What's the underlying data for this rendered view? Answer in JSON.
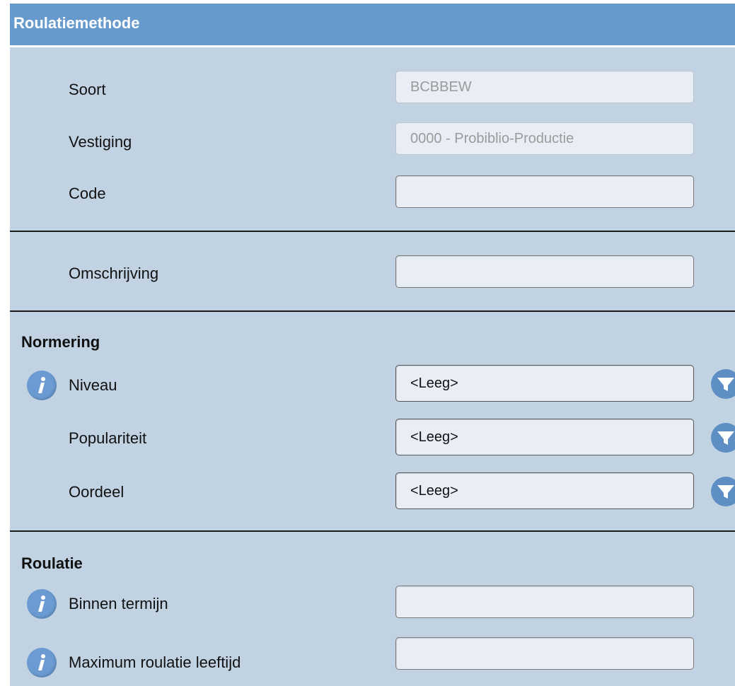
{
  "window": {
    "title": "Roulatiemethode"
  },
  "fields": {
    "soort": {
      "label": "Soort",
      "value": "BCBBEW"
    },
    "vestiging": {
      "label": "Vestiging",
      "value": "0000 - Probiblio-Productie"
    },
    "code": {
      "label": "Code",
      "value": ""
    },
    "omschrijving": {
      "label": "Omschrijving",
      "value": ""
    }
  },
  "normering": {
    "heading": "Normering",
    "niveau": {
      "label": "Niveau",
      "value": "<Leeg>"
    },
    "populariteit": {
      "label": "Populariteit",
      "value": "<Leeg>"
    },
    "oordeel": {
      "label": "Oordeel",
      "value": "<Leeg>"
    }
  },
  "roulatie": {
    "heading": "Roulatie",
    "binnen_termijn": {
      "label": "Binnen termijn",
      "value": ""
    },
    "max_leeftijd": {
      "label": "Maximum roulatie leeftijd",
      "value": ""
    }
  },
  "icons": {
    "info": "info-icon",
    "filter": "filter-icon"
  },
  "colors": {
    "titlebar": "#6699cc",
    "panel": "#c1d3e3",
    "field_bg": "#e9eef6",
    "icon_blue": "#6b9bd2"
  }
}
